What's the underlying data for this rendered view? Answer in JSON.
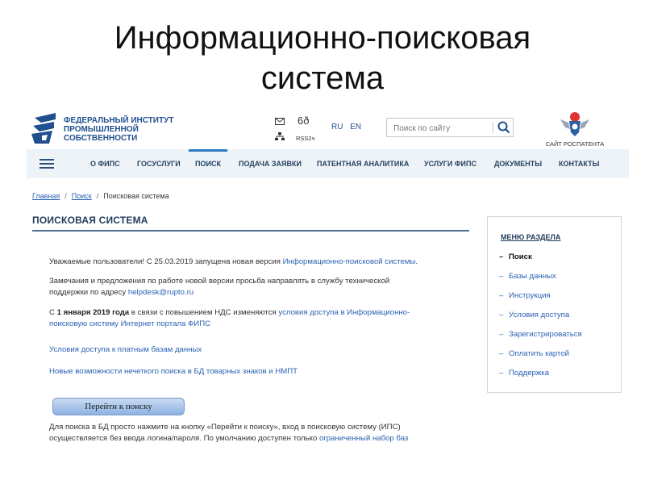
{
  "slide": {
    "title_line1": "Информационно-поисковая",
    "title_line2": "система"
  },
  "header": {
    "logo_lines": [
      "ФЕДЕРАЛЬНЫЙ ИНСТИТУТ",
      "ПРОМЫШЛЕННОЙ",
      "СОБСТВЕННОСТИ"
    ],
    "rss_label": "RSS2ч",
    "lang_ru": "RU",
    "lang_en": "EN",
    "search_placeholder": "Поиск по сайту",
    "rospatent_caption": "САЙТ РОСПАТЕНТА"
  },
  "nav": {
    "items": [
      {
        "label": "О ФИПС"
      },
      {
        "label": "ГОСУСЛУГИ"
      },
      {
        "label": "ПОИСК"
      },
      {
        "label": "ПОДАЧА ЗАЯВКИ"
      },
      {
        "label": "ПАТЕНТНАЯ АНАЛИТИКА"
      },
      {
        "label": "УСЛУГИ ФИПС"
      },
      {
        "label": "ДОКУМЕНТЫ"
      },
      {
        "label": "КОНТАКТЫ"
      }
    ],
    "active": "ПОИСК"
  },
  "breadcrumbs": {
    "home": "Главная",
    "search": "Поиск",
    "current": "Поисковая система"
  },
  "page": {
    "heading": "ПОИСКОВАЯ СИСТЕМА",
    "p1_text": "Уважаемые пользователи! С 25.03.2019 запущена новая версия ",
    "p1_link": "Информационно-поисковой системы",
    "p1_end": ".",
    "p2_text_a": "Замечания и предложения по работе новой версии просьба направлять в службу технической",
    "p2_text_b": "поддержки по адресу ",
    "p2_link": "helpdesk@rupto.ru",
    "p3_a": "С ",
    "p3_bold": "1 января 2019 года",
    "p3_b": " в связи с повышением НДС изменяются ",
    "p3_link_a": "условия доступа в Информационно-",
    "p3_link_b": "поисковую систему Интернет портала ФИПС",
    "link_paid": "Условия доступа к платным базам данных",
    "link_new": "Новые возможности нечеткого поиска в БД товарных знаков и НМПТ",
    "go_button": "Перейти к поиску",
    "p_bottom_a": "Для поиска в БД просто нажмите на кнопку «Перейти к поиску», вход в поисковую систему (ИПС)",
    "p_bottom_b": "осуществляется без ввода логина/пароля. По умолчанию доступен только ",
    "p_bottom_link": "ограниченный набор баз"
  },
  "side_menu": {
    "heading": "МЕНЮ РАЗДЕЛА",
    "items": [
      {
        "label": "Поиск",
        "active": true
      },
      {
        "label": "Базы данных"
      },
      {
        "label": "Инструкция"
      },
      {
        "label": "Условия доступа"
      },
      {
        "label": "Зарегистрироваться"
      },
      {
        "label": "Оплатить картой"
      },
      {
        "label": "Поддержка"
      }
    ]
  },
  "colors": {
    "brand_blue": "#1f4f8f",
    "link_blue": "#2a62b3",
    "nav_bg": "#eef3f8",
    "nav_active": "#2f78c4"
  },
  "icons": [
    "fips-logo-icon",
    "mail-icon",
    "sitemap-icon",
    "glasses-icon",
    "search-icon",
    "rospatent-emblem-icon",
    "menu-icon"
  ]
}
